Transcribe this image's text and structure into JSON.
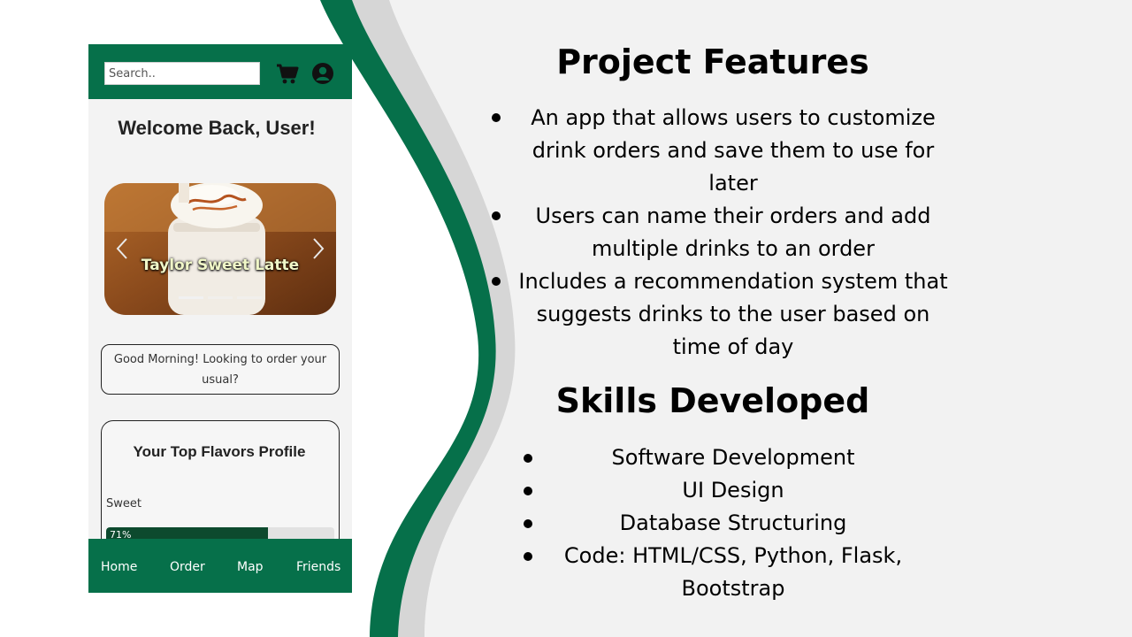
{
  "app": {
    "search_placeholder": "Search..",
    "icons": [
      "cart-icon",
      "user-icon"
    ],
    "welcome": "Welcome Back, User!",
    "carousel_caption": "Taylor Sweet Latte",
    "greeting": "Good Morning! Looking to order your usual?",
    "flavors_title": "Your Top Flavors Profile",
    "flavor_label": "Sweet",
    "flavor_value_percent": 71,
    "flavor_value_text": "71%",
    "nav": [
      "Home",
      "Order",
      "Map",
      "Friends"
    ],
    "accent_color": "#06704a"
  },
  "features": {
    "heading": "Project Features",
    "items": [
      "An app that allows users to customize drink orders and save them to use for later",
      "Users can name their orders and add multiple drinks to an order",
      "Includes a recommendation system that suggests drinks to the user based on time of day"
    ]
  },
  "skills": {
    "heading": "Skills Developed",
    "items": [
      "Software Development",
      "UI Design",
      "Database Structuring",
      "Code: HTML/CSS, Python, Flask, Bootstrap"
    ]
  }
}
